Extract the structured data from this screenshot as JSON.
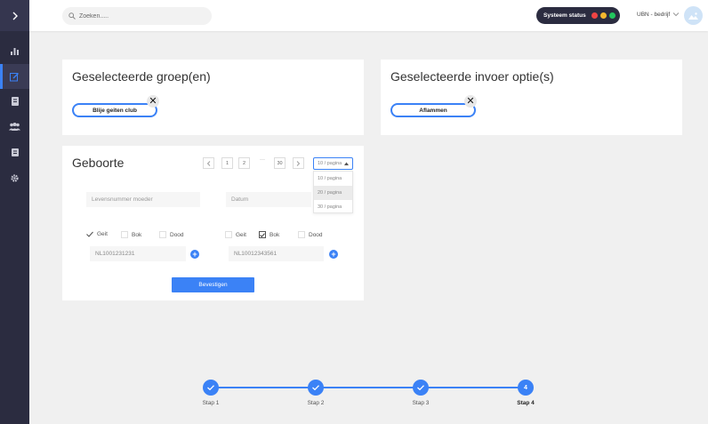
{
  "topbar": {
    "search_placeholder": "Zoeken.....",
    "status_label": "Systeem status",
    "status_colors": [
      "#ef4444",
      "#f5b82e",
      "#22c55e"
    ],
    "user_name": "UBN - bedrijf"
  },
  "sidebar": {
    "items": [
      {
        "icon": "chart-icon"
      },
      {
        "icon": "edit-icon",
        "active": true
      },
      {
        "icon": "document-icon"
      },
      {
        "icon": "users-icon"
      },
      {
        "icon": "list-icon"
      },
      {
        "icon": "gear-icon"
      }
    ]
  },
  "groups_card": {
    "title": "Geselecteerde groep(en)",
    "chip": "Blije geiten club"
  },
  "options_card": {
    "title": "Geselecteerde invoer optie(s)",
    "chip": "Aflammen"
  },
  "birth_card": {
    "title": "Geboorte",
    "pagination": {
      "pages": [
        "1",
        "2",
        "30"
      ],
      "ellipsis": "···"
    },
    "per_page": {
      "selected": "10 / pagina",
      "options": [
        "10 / pagina",
        "20 / pagina",
        "30 / pagina"
      ]
    },
    "mother_placeholder": "Levensnummer moeder",
    "date_placeholder": "Datum",
    "left_checks": [
      {
        "label": "Geit",
        "checked": true
      },
      {
        "label": "Bok",
        "checked": false
      },
      {
        "label": "Dood",
        "checked": false
      }
    ],
    "right_checks": [
      {
        "label": "Geit",
        "checked": false
      },
      {
        "label": "Bok",
        "checked": true
      },
      {
        "label": "Dood",
        "checked": false
      }
    ],
    "left_number": "NL1001231231",
    "right_number": "NL10012343561",
    "confirm_label": "Bevestigen"
  },
  "stepper": {
    "steps": [
      {
        "label": "Stap 1",
        "done": true
      },
      {
        "label": "Stap 2",
        "done": true
      },
      {
        "label": "Stap 3",
        "done": true
      },
      {
        "label": "Stap 4",
        "number": "4",
        "current": true
      }
    ]
  },
  "colors": {
    "accent": "#3b82f6",
    "sidebar": "#2b2c40"
  }
}
